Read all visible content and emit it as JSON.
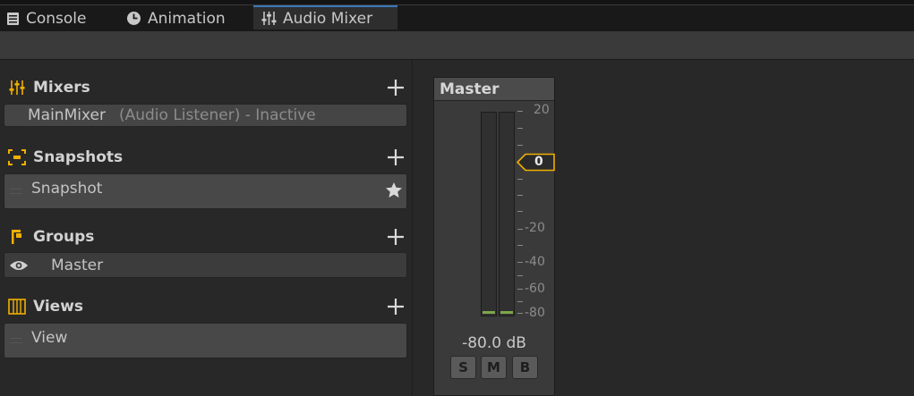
{
  "tabs": [
    {
      "label": "Console",
      "icon": "console-icon"
    },
    {
      "label": "Animation",
      "icon": "animation-clock-icon"
    },
    {
      "label": "Audio Mixer",
      "icon": "mixer-sliders-icon",
      "active": true
    }
  ],
  "colors": {
    "accent": "#f0b000",
    "tab_active_line": "#3a79bb",
    "meter_level": "#7da64a"
  },
  "sidebar": {
    "mixers": {
      "title": "Mixers",
      "items": [
        {
          "name": "MainMixer",
          "detail": "(Audio Listener) - Inactive"
        }
      ]
    },
    "snapshots": {
      "title": "Snapshots",
      "items": [
        {
          "name": "Snapshot",
          "starred": true
        }
      ]
    },
    "groups": {
      "title": "Groups",
      "items": [
        {
          "name": "Master",
          "visible": true
        }
      ]
    },
    "views": {
      "title": "Views",
      "items": [
        {
          "name": "View"
        }
      ]
    }
  },
  "strip": {
    "title": "Master",
    "scale_labels": {
      "top": "20",
      "zero": "0",
      "m20": "-20",
      "m40": "-40",
      "m60": "-60",
      "m80": "-80"
    },
    "fader_value": "0",
    "readout": "-80.0 dB",
    "solo_label": "S",
    "mute_label": "M",
    "bypass_label": "B"
  }
}
